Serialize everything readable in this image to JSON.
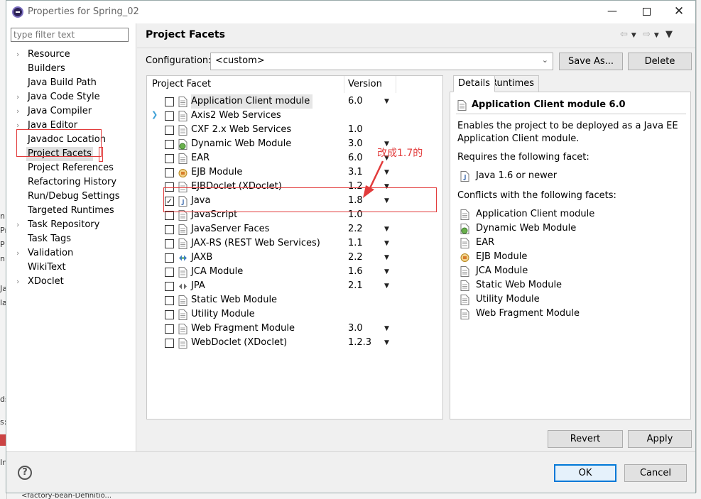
{
  "window": {
    "title": "Properties for Spring_02"
  },
  "filter": {
    "placeholder": "type filter text"
  },
  "tree": [
    {
      "label": "Resource",
      "expandable": true
    },
    {
      "label": "Builders",
      "expandable": false
    },
    {
      "label": "Java Build Path",
      "expandable": false
    },
    {
      "label": "Java Code Style",
      "expandable": true
    },
    {
      "label": "Java Compiler",
      "expandable": true
    },
    {
      "label": "Java Editor",
      "expandable": true
    },
    {
      "label": "Javadoc Location",
      "expandable": false
    },
    {
      "label": "Project Facets",
      "expandable": false,
      "selected": true
    },
    {
      "label": "Project References",
      "expandable": false
    },
    {
      "label": "Refactoring History",
      "expandable": false
    },
    {
      "label": "Run/Debug Settings",
      "expandable": false
    },
    {
      "label": "Targeted Runtimes",
      "expandable": false
    },
    {
      "label": "Task Repository",
      "expandable": true
    },
    {
      "label": "Task Tags",
      "expandable": false
    },
    {
      "label": "Validation",
      "expandable": true
    },
    {
      "label": "WikiText",
      "expandable": false
    },
    {
      "label": "XDoclet",
      "expandable": true
    }
  ],
  "page": {
    "title": "Project Facets"
  },
  "config": {
    "label": "Configuration:",
    "value": "<custom>",
    "save_as": "Save As...",
    "delete": "Delete"
  },
  "facets_header": {
    "name": "Project Facet",
    "version": "Version"
  },
  "facets": [
    {
      "name": "Application Client module",
      "version": "6.0",
      "dropdown": true,
      "checked": false,
      "highlight": true,
      "icon": "page-icon"
    },
    {
      "name": "Axis2 Web Services",
      "version": "",
      "dropdown": false,
      "checked": false,
      "expander": true,
      "icon": "page-icon"
    },
    {
      "name": "CXF 2.x Web Services",
      "version": "1.0",
      "dropdown": false,
      "checked": false,
      "icon": "page-icon"
    },
    {
      "name": "Dynamic Web Module",
      "version": "3.0",
      "dropdown": true,
      "checked": false,
      "icon": "globe-page-icon"
    },
    {
      "name": "EAR",
      "version": "6.0",
      "dropdown": true,
      "checked": false,
      "icon": "page-icon"
    },
    {
      "name": "EJB Module",
      "version": "3.1",
      "dropdown": true,
      "checked": false,
      "icon": "bean-icon"
    },
    {
      "name": "EJBDoclet (XDoclet)",
      "version": "1.2",
      "dropdown": true,
      "checked": false,
      "icon": "page-icon"
    },
    {
      "name": "Java",
      "version": "1.8",
      "dropdown": true,
      "checked": true,
      "icon": "java-icon"
    },
    {
      "name": "JavaScript",
      "version": "1.0",
      "dropdown": false,
      "checked": false,
      "icon": "page-icon"
    },
    {
      "name": "JavaServer Faces",
      "version": "2.2",
      "dropdown": true,
      "checked": false,
      "icon": "page-icon"
    },
    {
      "name": "JAX-RS (REST Web Services)",
      "version": "1.1",
      "dropdown": true,
      "checked": false,
      "icon": "page-icon"
    },
    {
      "name": "JAXB",
      "version": "2.2",
      "dropdown": true,
      "checked": false,
      "icon": "jaxb-icon"
    },
    {
      "name": "JCA Module",
      "version": "1.6",
      "dropdown": true,
      "checked": false,
      "icon": "page-icon"
    },
    {
      "name": "JPA",
      "version": "2.1",
      "dropdown": true,
      "checked": false,
      "icon": "jpa-icon"
    },
    {
      "name": "Static Web Module",
      "version": "",
      "dropdown": false,
      "checked": false,
      "icon": "page-icon"
    },
    {
      "name": "Utility Module",
      "version": "",
      "dropdown": false,
      "checked": false,
      "icon": "page-icon"
    },
    {
      "name": "Web Fragment Module",
      "version": "3.0",
      "dropdown": true,
      "checked": false,
      "icon": "page-icon"
    },
    {
      "name": "WebDoclet (XDoclet)",
      "version": "1.2.3",
      "dropdown": true,
      "checked": false,
      "icon": "page-icon"
    }
  ],
  "annotation": {
    "text": "改成1.7的",
    "color": "#e23b3b"
  },
  "details": {
    "tabs": [
      "Details",
      "Runtimes"
    ],
    "title": "Application Client module 6.0",
    "description": "Enables the project to be deployed as a Java EE Application Client module.",
    "requires_label": "Requires the following facet:",
    "requires": [
      "Java 1.6 or newer"
    ],
    "conflicts_label": "Conflicts with the following facets:",
    "conflicts": [
      "Application Client module",
      "Dynamic Web Module",
      "EAR",
      "EJB Module",
      "JCA Module",
      "Static Web Module",
      "Utility Module",
      "Web Fragment Module"
    ]
  },
  "buttons": {
    "revert": "Revert",
    "apply": "Apply",
    "ok": "OK",
    "cancel": "Cancel"
  },
  "background": {
    "left_fragments": [
      "ni",
      "Pr",
      "P",
      "n",
      "Ja",
      "la",
      "ds",
      "s:",
      "In"
    ],
    "bottom_text": "<factory-bean-Definitio..."
  },
  "colors": {
    "accent": "#0078d7",
    "annotation_red": "#e23b3b"
  }
}
